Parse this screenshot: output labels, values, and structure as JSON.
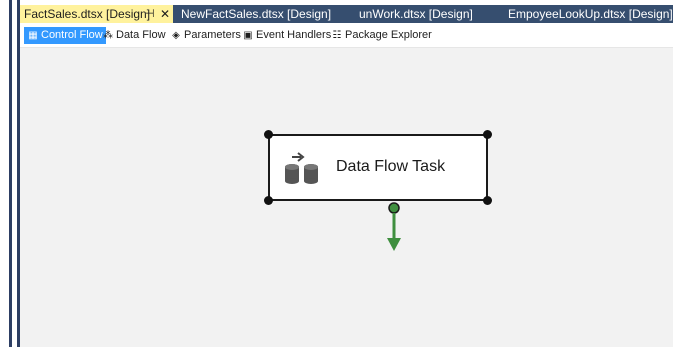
{
  "tabs": [
    {
      "label": "FactSales.dtsx [Design]",
      "active": true
    },
    {
      "label": "NewFactSales.dtsx [Design]",
      "active": false
    },
    {
      "label": "unWork.dtsx [Design]",
      "active": false
    },
    {
      "label": "EmpoyeeLookUp.dtsx [Design]",
      "active": false
    }
  ],
  "tab_icons": {
    "pin": "pin-icon",
    "close": "close-icon"
  },
  "toolbar": {
    "items": [
      {
        "label": "Control Flow",
        "icon": "control-flow-icon",
        "selected": true
      },
      {
        "label": "Data Flow",
        "icon": "data-flow-icon",
        "selected": false
      },
      {
        "label": "Parameters",
        "icon": "parameters-icon",
        "selected": false
      },
      {
        "label": "Event Handlers",
        "icon": "event-handlers-icon",
        "selected": false
      },
      {
        "label": "Package Explorer",
        "icon": "package-explorer-icon",
        "selected": false
      }
    ]
  },
  "task": {
    "label": "Data Flow Task",
    "icon": "data-flow-task-icon"
  },
  "colors": {
    "tab_active": "#fff29d",
    "tabstrip": "#364e6f",
    "selected": "#3399ff",
    "canvas": "#f2f2f2",
    "connector": "#3f8f3f"
  }
}
